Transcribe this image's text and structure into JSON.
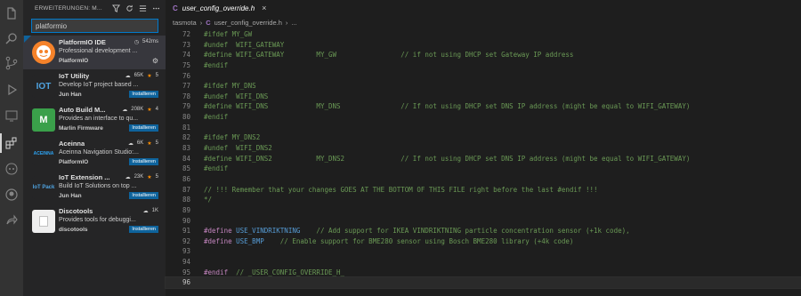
{
  "sidebar": {
    "title": "ERWEITERUNGEN: M...",
    "search_value": "platformio",
    "extensions": [
      {
        "name": "PlatformIO IDE",
        "stats": "542ms",
        "rating": "",
        "description": "Professional development ...",
        "publisher": "PlatformIO",
        "action": "",
        "icon_text": "",
        "icon_color": "#f5822a"
      },
      {
        "name": "IoT Utility",
        "stats": "65K",
        "rating": "5",
        "description": "Develop IoT project based ...",
        "publisher": "Jun Han",
        "action": "Installieren",
        "icon_text": "IOT",
        "icon_color": "#2b2b2b"
      },
      {
        "name": "Auto Build M...",
        "stats": "208K",
        "rating": "4",
        "description": "Provides an interface to qu...",
        "publisher": "Marlin Firmware",
        "action": "Installieren",
        "icon_text": "M",
        "icon_color": "#3aa04a"
      },
      {
        "name": "Aceinna",
        "stats": "6K",
        "rating": "5",
        "description": "Aceinna Navigation Studio:...",
        "publisher": "PlatformIO",
        "action": "Installieren",
        "icon_text": "ACEINNA",
        "icon_color": "#1e1e1e"
      },
      {
        "name": "IoT Extension ...",
        "stats": "23K",
        "rating": "5",
        "description": "Build IoT Solutions on top ...",
        "publisher": "Jun Han",
        "action": "Installieren",
        "icon_text": "IoT Pack",
        "icon_color": "#1e1e1e"
      },
      {
        "name": "Discotools",
        "stats": "1K",
        "rating": "",
        "description": "Provides tools for debuggi...",
        "publisher": "discotools",
        "action": "Installieren",
        "icon_text": "",
        "icon_color": "#eeeeee"
      }
    ]
  },
  "editor": {
    "tab_lang": "C",
    "tab_title": "user_config_override.h",
    "tab_close": "×",
    "breadcrumb": [
      "tasmota",
      "C",
      "user_config_override.h",
      "..."
    ]
  },
  "code_lines": [
    {
      "n": "72",
      "segs": [
        {
          "t": "#ifdef MY_GW",
          "c": "cmt"
        }
      ]
    },
    {
      "n": "73",
      "segs": [
        {
          "t": "#undef  WIFI_GATEWAY",
          "c": "cmt"
        }
      ]
    },
    {
      "n": "74",
      "segs": [
        {
          "t": "#define WIFI_GATEWAY        MY_GW                // if not using DHCP set Gateway IP address",
          "c": "cmt"
        }
      ]
    },
    {
      "n": "75",
      "segs": [
        {
          "t": "#endif",
          "c": "cmt"
        }
      ]
    },
    {
      "n": "76",
      "segs": []
    },
    {
      "n": "77",
      "segs": [
        {
          "t": "#ifdef MY_DNS",
          "c": "cmt"
        }
      ]
    },
    {
      "n": "78",
      "segs": [
        {
          "t": "#undef  WIFI_DNS",
          "c": "cmt"
        }
      ]
    },
    {
      "n": "79",
      "segs": [
        {
          "t": "#define WIFI_DNS            MY_DNS               // If not using DHCP set DNS IP address (might be equal to WIFI_GATEWAY)",
          "c": "cmt"
        }
      ]
    },
    {
      "n": "80",
      "segs": [
        {
          "t": "#endif",
          "c": "cmt"
        }
      ]
    },
    {
      "n": "81",
      "segs": []
    },
    {
      "n": "82",
      "segs": [
        {
          "t": "#ifdef MY_DNS2",
          "c": "cmt"
        }
      ]
    },
    {
      "n": "83",
      "segs": [
        {
          "t": "#undef  WIFI_DNS2",
          "c": "cmt"
        }
      ]
    },
    {
      "n": "84",
      "segs": [
        {
          "t": "#define WIFI_DNS2           MY_DNS2              // If not using DHCP set DNS IP address (might be equal to WIFI_GATEWAY)",
          "c": "cmt"
        }
      ]
    },
    {
      "n": "85",
      "segs": [
        {
          "t": "#endif",
          "c": "cmt"
        }
      ]
    },
    {
      "n": "86",
      "segs": []
    },
    {
      "n": "87",
      "segs": [
        {
          "t": "// !!! Remember that your changes GOES AT THE BOTTOM OF THIS FILE right before the last #endif !!!",
          "c": "cmt"
        }
      ]
    },
    {
      "n": "88",
      "segs": [
        {
          "t": "*/",
          "c": "cmt"
        }
      ]
    },
    {
      "n": "89",
      "segs": []
    },
    {
      "n": "90",
      "segs": []
    },
    {
      "n": "91",
      "segs": [
        {
          "t": "#define ",
          "c": "kw"
        },
        {
          "t": "USE_VINDRIKTNING",
          "c": "mac"
        },
        {
          "t": "    // Add support for IKEA VINDRIKTNING particle concentration sensor (+1k code),",
          "c": "cmt"
        }
      ]
    },
    {
      "n": "92",
      "segs": [
        {
          "t": "#define ",
          "c": "kw"
        },
        {
          "t": "USE_BMP",
          "c": "mac"
        },
        {
          "t": "    // Enable support for BME280 sensor using Bosch BME280 library (+4k code)",
          "c": "cmt"
        }
      ]
    },
    {
      "n": "93",
      "segs": []
    },
    {
      "n": "94",
      "segs": []
    },
    {
      "n": "95",
      "segs": [
        {
          "t": "#endif",
          "c": "kw"
        },
        {
          "t": "  // _USER_CONFIG_OVERRIDE_H_",
          "c": "cmt"
        }
      ]
    },
    {
      "n": "96",
      "segs": [],
      "current": true
    }
  ]
}
